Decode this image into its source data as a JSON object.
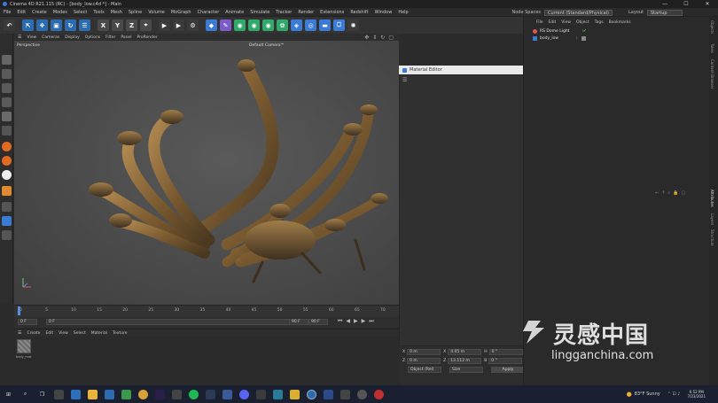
{
  "window": {
    "title": "Cinema 4D R21.115 (RC) - [body_low.c4d *] - Main",
    "controls": [
      "—",
      "☐",
      "✕"
    ]
  },
  "menubar": {
    "items": [
      "File",
      "Edit",
      "Create",
      "Modes",
      "Select",
      "Tools",
      "Mesh",
      "Spline",
      "Volume",
      "MoGraph",
      "Character",
      "Animate",
      "Simulate",
      "Tracker",
      "Render",
      "Extensions",
      "Redshift",
      "Window",
      "Help"
    ],
    "node_spaces_label": "Node Spaces",
    "node_spaces_value": "Current (Standard/Physical)",
    "layout_label": "Layout",
    "layout_value": "Startup"
  },
  "toolbar": {
    "buttons": [
      {
        "name": "undo-icon",
        "glyph": "↶",
        "color": "#3a3a3a"
      },
      {
        "name": "live-select-icon",
        "glyph": "⇱",
        "color": "#2b6cb0"
      },
      {
        "name": "move-icon",
        "glyph": "✥",
        "color": "#2b6cb0"
      },
      {
        "name": "scale-icon",
        "glyph": "▣",
        "color": "#2b6cb0"
      },
      {
        "name": "rotate-icon",
        "glyph": "↻",
        "color": "#2b6cb0"
      },
      {
        "name": "recent-tools-icon",
        "glyph": "☰",
        "color": "#2b6cb0"
      },
      {
        "name": "x-axis-icon",
        "glyph": "X",
        "color": "#4a4a4a"
      },
      {
        "name": "y-axis-icon",
        "glyph": "Y",
        "color": "#4a4a4a"
      },
      {
        "name": "z-axis-icon",
        "glyph": "Z",
        "color": "#4a4a4a"
      },
      {
        "name": "coordinate-system-icon",
        "glyph": "⌖",
        "color": "#4a4a4a"
      },
      {
        "name": "render-view-icon",
        "glyph": "▶",
        "color": "#3a3a3a"
      },
      {
        "name": "render-picture-viewer-icon",
        "glyph": "▶",
        "color": "#3a3a3a"
      },
      {
        "name": "render-settings-icon",
        "glyph": "⚙",
        "color": "#3a3a3a"
      },
      {
        "name": "cube-icon",
        "glyph": "◆",
        "color": "#3a7bd5"
      },
      {
        "name": "pen-icon",
        "glyph": "✎",
        "color": "#7a5bc8"
      },
      {
        "name": "subdivision-icon",
        "glyph": "◉",
        "color": "#2fa86a"
      },
      {
        "name": "array-icon",
        "glyph": "◉",
        "color": "#2fa86a"
      },
      {
        "name": "boole-icon",
        "glyph": "◉",
        "color": "#2fa86a"
      },
      {
        "name": "volume-builder-icon",
        "glyph": "✿",
        "color": "#2fa86a"
      },
      {
        "name": "bend-deformer-icon",
        "glyph": "◈",
        "color": "#3a7bd5"
      },
      {
        "name": "field-icon",
        "glyph": "◎",
        "color": "#3a7bd5"
      },
      {
        "name": "floor-icon",
        "glyph": "▬",
        "color": "#3a7bd5"
      },
      {
        "name": "camera-icon",
        "glyph": "⎕",
        "color": "#3a7bd5"
      },
      {
        "name": "light-icon",
        "glyph": "✺",
        "color": "#3a3a3a"
      }
    ]
  },
  "viewport": {
    "menu": [
      "View",
      "Cameras",
      "Display",
      "Options",
      "Filter",
      "Panel",
      "ProRender"
    ],
    "label": "Perspective",
    "camera": "Default Camera'*"
  },
  "timeline": {
    "ticks": [
      "0",
      "5",
      "10",
      "15",
      "20",
      "25",
      "30",
      "35",
      "40",
      "45",
      "50",
      "55",
      "60",
      "65",
      "70"
    ],
    "start": "0 F",
    "current": "0 F",
    "end": "90 F",
    "end2": "90 F"
  },
  "material_manager": {
    "menu": [
      "Create",
      "Edit",
      "View",
      "Select",
      "Material",
      "Texture"
    ],
    "material_name": "body_mat"
  },
  "material_editor": {
    "title": "Material Editor",
    "controls": [
      "—",
      "☐",
      "✕"
    ]
  },
  "coordinates": {
    "rows": [
      {
        "axis": "X",
        "pos": "0 m",
        "size_axis": "X",
        "size": "4.05 m",
        "rot_axis": "H",
        "rot": "0 °"
      },
      {
        "axis": "Z",
        "pos": "0 m",
        "size_axis": "Z",
        "size": "13.112 m",
        "rot_axis": "B",
        "rot": "0 °"
      }
    ],
    "mode": "Object (Rel)",
    "size_mode": "Size",
    "apply": "Apply"
  },
  "object_manager": {
    "menu": [
      "File",
      "Edit",
      "View",
      "Object",
      "Tags",
      "Bookmarks"
    ],
    "objects": [
      {
        "name": "RS Dome Light",
        "color": "#e05555"
      },
      {
        "name": "body_low",
        "color": "#cfcfcf"
      }
    ]
  },
  "side_tabs": [
    "Objects",
    "Takes",
    "Content Browser",
    "Attributes",
    "Layers",
    "Structure"
  ],
  "taskbar": {
    "weather": "83°F  Sunny",
    "time": "6:52 PM",
    "date": "7/23/2021"
  },
  "watermark": {
    "cn": "灵感中国",
    "en": "lingganchina.com"
  }
}
